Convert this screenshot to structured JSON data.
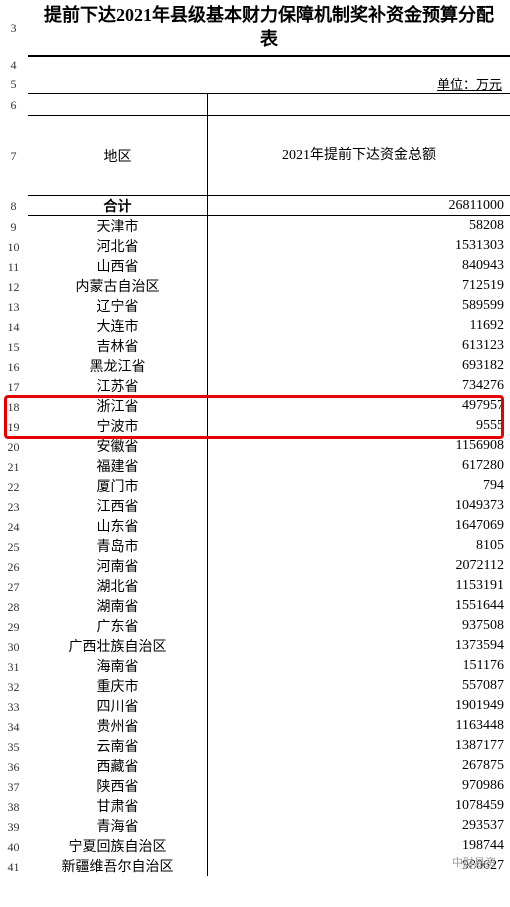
{
  "title": "提前下达2021年县级基本财力保障机制奖补资金预算分配表",
  "unit_label": "单位：万元",
  "headers": {
    "region": "地区",
    "amount": "2021年提前下达资金总额"
  },
  "total": {
    "label": "合计",
    "value": "26811000"
  },
  "rows": [
    {
      "region": "天津市",
      "value": "58208"
    },
    {
      "region": "河北省",
      "value": "1531303"
    },
    {
      "region": "山西省",
      "value": "840943"
    },
    {
      "region": "内蒙古自治区",
      "value": "712519"
    },
    {
      "region": "辽宁省",
      "value": "589599"
    },
    {
      "region": "大连市",
      "value": "11692"
    },
    {
      "region": "吉林省",
      "value": "613123"
    },
    {
      "region": "黑龙江省",
      "value": "693182"
    },
    {
      "region": "江苏省",
      "value": "734276"
    },
    {
      "region": "浙江省",
      "value": "497957"
    },
    {
      "region": "宁波市",
      "value": "9555"
    },
    {
      "region": "安徽省",
      "value": "1156908"
    },
    {
      "region": "福建省",
      "value": "617280"
    },
    {
      "region": "厦门市",
      "value": "794"
    },
    {
      "region": "江西省",
      "value": "1049373"
    },
    {
      "region": "山东省",
      "value": "1647069"
    },
    {
      "region": "青岛市",
      "value": "8105"
    },
    {
      "region": "河南省",
      "value": "2072112"
    },
    {
      "region": "湖北省",
      "value": "1153191"
    },
    {
      "region": "湖南省",
      "value": "1551644"
    },
    {
      "region": "广东省",
      "value": "937508"
    },
    {
      "region": "广西壮族自治区",
      "value": "1373594"
    },
    {
      "region": "海南省",
      "value": "151176"
    },
    {
      "region": "重庆市",
      "value": "557087"
    },
    {
      "region": "四川省",
      "value": "1901949"
    },
    {
      "region": "贵州省",
      "value": "1163448"
    },
    {
      "region": "云南省",
      "value": "1387177"
    },
    {
      "region": "西藏省",
      "value": "267875"
    },
    {
      "region": "陕西省",
      "value": "970986"
    },
    {
      "region": "甘肃省",
      "value": "1078459"
    },
    {
      "region": "青海省",
      "value": "293537"
    },
    {
      "region": "宁夏回族自治区",
      "value": "198744"
    },
    {
      "region": "新疆维吾尔自治区",
      "value": "980627"
    }
  ],
  "row_numbers_start": 3,
  "highlight_rows": [
    18,
    19
  ],
  "watermark": "中财易资",
  "chart_data": {
    "type": "table",
    "title": "提前下达2021年县级基本财力保障机制奖补资金预算分配表",
    "unit": "万元",
    "columns": [
      "地区",
      "2021年提前下达资金总额"
    ],
    "total": [
      "合计",
      26811000
    ],
    "data": [
      [
        "天津市",
        58208
      ],
      [
        "河北省",
        1531303
      ],
      [
        "山西省",
        840943
      ],
      [
        "内蒙古自治区",
        712519
      ],
      [
        "辽宁省",
        589599
      ],
      [
        "大连市",
        11692
      ],
      [
        "吉林省",
        613123
      ],
      [
        "黑龙江省",
        693182
      ],
      [
        "江苏省",
        734276
      ],
      [
        "浙江省",
        497957
      ],
      [
        "宁波市",
        9555
      ],
      [
        "安徽省",
        1156908
      ],
      [
        "福建省",
        617280
      ],
      [
        "厦门市",
        794
      ],
      [
        "江西省",
        1049373
      ],
      [
        "山东省",
        1647069
      ],
      [
        "青岛市",
        8105
      ],
      [
        "河南省",
        2072112
      ],
      [
        "湖北省",
        1153191
      ],
      [
        "湖南省",
        1551644
      ],
      [
        "广东省",
        937508
      ],
      [
        "广西壮族自治区",
        1373594
      ],
      [
        "海南省",
        151176
      ],
      [
        "重庆市",
        557087
      ],
      [
        "四川省",
        1901949
      ],
      [
        "贵州省",
        1163448
      ],
      [
        "云南省",
        1387177
      ],
      [
        "西藏省",
        267875
      ],
      [
        "陕西省",
        970986
      ],
      [
        "甘肃省",
        1078459
      ],
      [
        "青海省",
        293537
      ],
      [
        "宁夏回族自治区",
        198744
      ],
      [
        "新疆维吾尔自治区",
        980627
      ]
    ]
  }
}
